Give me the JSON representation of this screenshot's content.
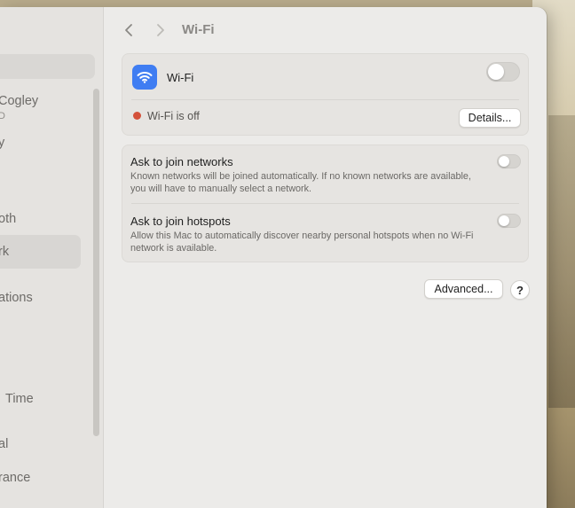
{
  "sidebar": {
    "items": [
      {
        "label": "Cogley"
      },
      {
        "label": "D"
      },
      {
        "label": "y"
      },
      {
        "label": "oth"
      },
      {
        "label": "rk"
      },
      {
        "label": "ations"
      },
      {
        "label": "Time"
      },
      {
        "label": "al"
      },
      {
        "label": "rance"
      }
    ]
  },
  "toolbar": {
    "back_icon": "chevron-left-icon",
    "forward_icon": "chevron-right-icon",
    "title": "Wi-Fi"
  },
  "wifi_card": {
    "icon": "wifi-icon",
    "label": "Wi-Fi",
    "toggle_on": false,
    "status_text": "Wi-Fi is off",
    "status_color": "#d4513a",
    "details_label": "Details..."
  },
  "join_card": {
    "networks": {
      "label": "Ask to join networks",
      "description": "Known networks will be joined automatically. If no known networks are available, you will have to manually select a network.",
      "toggle_on": false
    },
    "hotspots": {
      "label": "Ask to join hotspots",
      "description": "Allow this Mac to automatically discover nearby personal hotspots when no Wi-Fi network is available.",
      "toggle_on": false
    }
  },
  "footer": {
    "advanced_label": "Advanced...",
    "help_label": "?"
  },
  "colors": {
    "accent": "#3f7df2",
    "window_bg": "#ecebe9"
  }
}
